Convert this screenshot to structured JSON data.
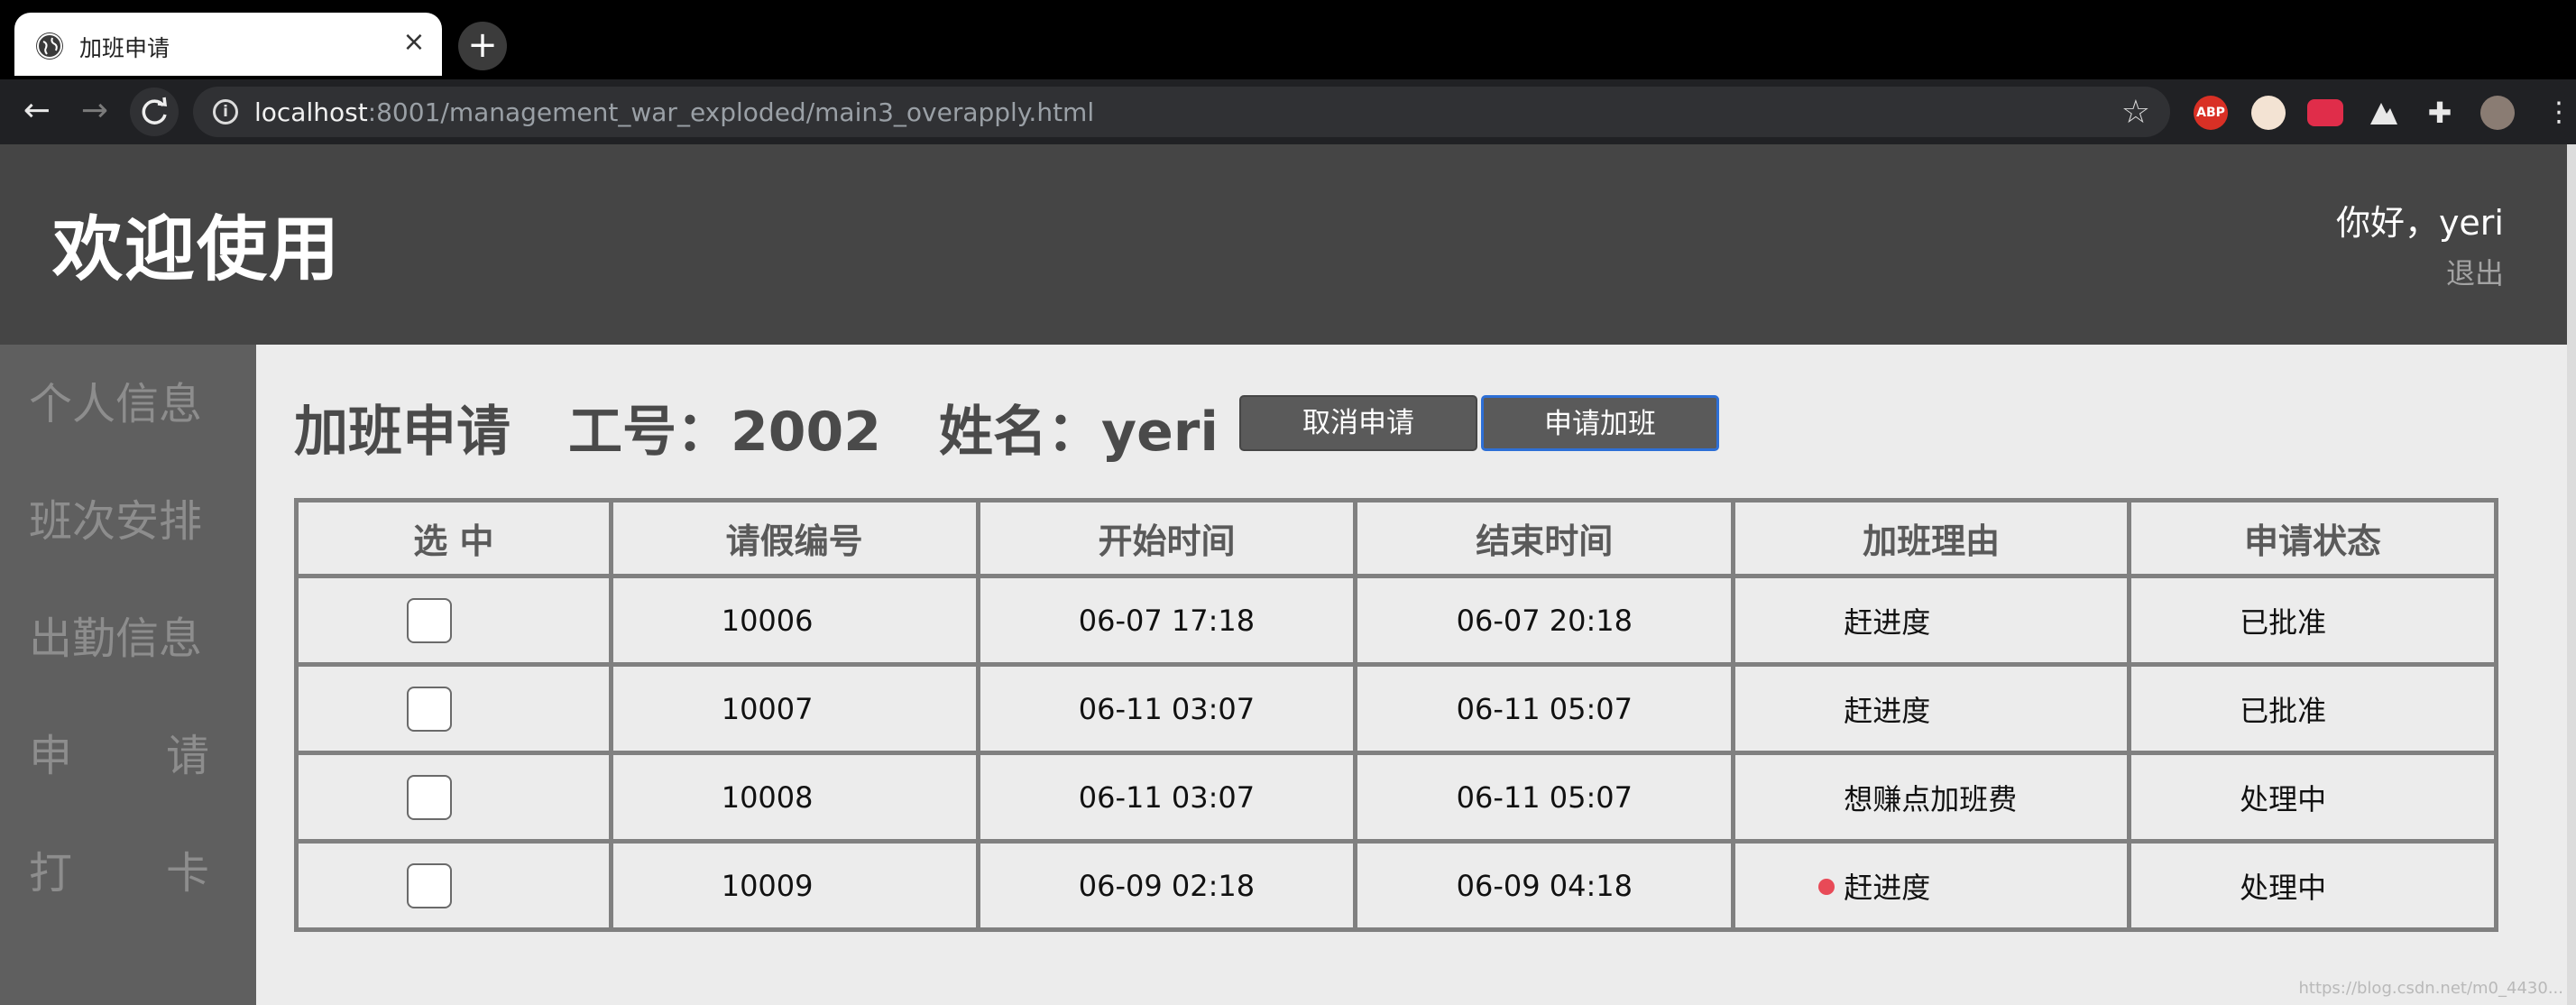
{
  "browser": {
    "tab_title": "加班申请",
    "url_host": "localhost",
    "url_rest": ":8001/management_war_exploded/main3_overapply.html"
  },
  "header": {
    "title": "欢迎使用",
    "greeting": "你好，yeri",
    "logout": "退出"
  },
  "sidebar": {
    "items": [
      {
        "label": "个人信息"
      },
      {
        "label": "班次安排"
      },
      {
        "label": "出勤信息"
      },
      {
        "left": "申",
        "right": "请"
      },
      {
        "left": "打",
        "right": "卡"
      }
    ]
  },
  "main": {
    "title": "加班申请",
    "employee_id": "工号：2002",
    "employee_name": "姓名：yeri",
    "cancel_button": "取消申请",
    "apply_button": "申请加班",
    "columns": [
      "选 中",
      "请假编号",
      "开始时间",
      "结束时间",
      "加班理由",
      "申请状态"
    ],
    "rows": [
      {
        "id": "10006",
        "start": "06-07 17:18",
        "end": "06-07 20:18",
        "reason": "赶进度",
        "status": "已批准"
      },
      {
        "id": "10007",
        "start": "06-11 03:07",
        "end": "06-11 05:07",
        "reason": "赶进度",
        "status": "已批准"
      },
      {
        "id": "10008",
        "start": "06-11 03:07",
        "end": "06-11 05:07",
        "reason": "想赚点加班费",
        "status": "处理中"
      },
      {
        "id": "10009",
        "start": "06-09 02:18",
        "end": "06-09 04:18",
        "reason": "赶进度",
        "status": "处理中"
      }
    ]
  },
  "watermark": "https://blog.csdn.net/m0_4430..."
}
